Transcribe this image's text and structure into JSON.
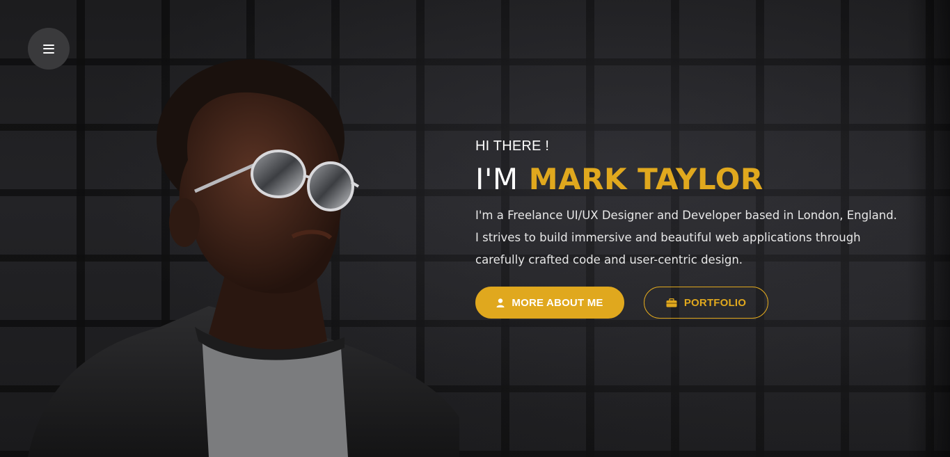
{
  "menu": {
    "icon": "hamburger-menu-icon"
  },
  "hero": {
    "greeting": "HI THERE !",
    "headline_prefix": "I'M",
    "headline_name": "MARK TAYLOR",
    "bio_lines": [
      "I'm a Freelance UI/UX Designer and Developer based in London, England.",
      "I strives to build immersive and beautiful web applications through",
      "carefully crafted code and user-centric design."
    ]
  },
  "actions": {
    "primary_label": "MORE ABOUT ME",
    "primary_icon": "user-icon",
    "secondary_label": "PORTFOLIO",
    "secondary_icon": "briefcase-icon"
  },
  "colors": {
    "accent": "#e0a81e",
    "text": "#ffffff",
    "menu_button": "#3a3a3c"
  }
}
